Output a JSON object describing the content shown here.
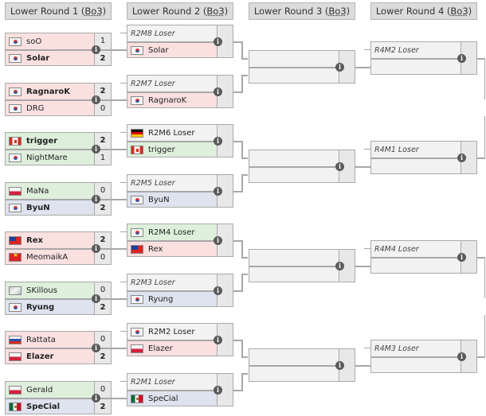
{
  "headers": [
    {
      "prefix": "Lower Round 1 (",
      "abbr": "Bo3",
      "suffix": ")"
    },
    {
      "prefix": "Lower Round 2 (",
      "abbr": "Bo3",
      "suffix": ")"
    },
    {
      "prefix": "Lower Round 3 (",
      "abbr": "Bo3",
      "suffix": ")"
    },
    {
      "prefix": "Lower Round 4 (",
      "abbr": "Bo3",
      "suffix": ")"
    }
  ],
  "round1": [
    {
      "p1": {
        "name": "soO",
        "flag": "kr",
        "score": "1",
        "win": false
      },
      "p2": {
        "name": "Solar",
        "flag": "kr",
        "score": "2",
        "win": true
      },
      "bg": [
        "red",
        "red"
      ]
    },
    {
      "p1": {
        "name": "RagnaroK",
        "flag": "kr",
        "score": "2",
        "win": true
      },
      "p2": {
        "name": "DRG",
        "flag": "kr",
        "score": "0",
        "win": false
      },
      "bg": [
        "red",
        "red"
      ]
    },
    {
      "p1": {
        "name": "trigger",
        "flag": "ca",
        "score": "2",
        "win": true
      },
      "p2": {
        "name": "NightMare",
        "flag": "kr",
        "score": "1",
        "win": false
      },
      "bg": [
        "green",
        "green"
      ]
    },
    {
      "p1": {
        "name": "MaNa",
        "flag": "pl",
        "score": "0",
        "win": false
      },
      "p2": {
        "name": "ByuN",
        "flag": "kr",
        "score": "2",
        "win": true
      },
      "bg": [
        "green",
        "blue"
      ]
    },
    {
      "p1": {
        "name": "Rex",
        "flag": "tw",
        "score": "2",
        "win": true
      },
      "p2": {
        "name": "MeomaikA",
        "flag": "vn",
        "score": "0",
        "win": false
      },
      "bg": [
        "red",
        "red"
      ]
    },
    {
      "p1": {
        "name": "SKillous",
        "flag": "unk",
        "score": "0",
        "win": false
      },
      "p2": {
        "name": "Ryung",
        "flag": "kr",
        "score": "2",
        "win": true
      },
      "bg": [
        "green",
        "blue"
      ]
    },
    {
      "p1": {
        "name": "Rattata",
        "flag": "ru",
        "score": "0",
        "win": false
      },
      "p2": {
        "name": "Elazer",
        "flag": "pl",
        "score": "2",
        "win": true
      },
      "bg": [
        "red",
        "red"
      ]
    },
    {
      "p1": {
        "name": "Gerald",
        "flag": "pl",
        "score": "0",
        "win": false
      },
      "p2": {
        "name": "SpeCial",
        "flag": "mx",
        "score": "2",
        "win": true
      },
      "bg": [
        "green",
        "blue"
      ]
    }
  ],
  "round2": [
    {
      "top": {
        "label": "R2M8 Loser",
        "flag": "",
        "italic": true,
        "bg": "grey"
      },
      "bottom": {
        "label": "Solar",
        "flag": "kr",
        "bg": "red"
      }
    },
    {
      "top": {
        "label": "R2M7 Loser",
        "flag": "",
        "italic": true,
        "bg": "grey"
      },
      "bottom": {
        "label": "RagnaroK",
        "flag": "kr",
        "bg": "red"
      }
    },
    {
      "top": {
        "label": "R2M6 Loser",
        "flag": "de",
        "italic": false,
        "bg": "grey"
      },
      "bottom": {
        "label": "trigger",
        "flag": "ca",
        "bg": "green"
      }
    },
    {
      "top": {
        "label": "R2M5 Loser",
        "flag": "",
        "italic": true,
        "bg": "grey"
      },
      "bottom": {
        "label": "ByuN",
        "flag": "kr",
        "bg": "blue"
      }
    },
    {
      "top": {
        "label": "R2M4 Loser",
        "flag": "kr",
        "italic": false,
        "bg": "green"
      },
      "bottom": {
        "label": "Rex",
        "flag": "tw",
        "bg": "red"
      }
    },
    {
      "top": {
        "label": "R2M3 Loser",
        "flag": "",
        "italic": true,
        "bg": "grey"
      },
      "bottom": {
        "label": "Ryung",
        "flag": "kr",
        "bg": "blue"
      }
    },
    {
      "top": {
        "label": "R2M2 Loser",
        "flag": "kr",
        "italic": false,
        "bg": "grey"
      },
      "bottom": {
        "label": "Elazer",
        "flag": "pl",
        "bg": "red"
      }
    },
    {
      "top": {
        "label": "R2M1 Loser",
        "flag": "",
        "italic": true,
        "bg": "grey"
      },
      "bottom": {
        "label": "SpeCial",
        "flag": "mx",
        "bg": "blue"
      }
    }
  ],
  "round3": [
    {},
    {},
    {},
    {}
  ],
  "round4": [
    {
      "top": {
        "label": "R4M2 Loser"
      }
    },
    {
      "top": {
        "label": "R4M1 Loser"
      }
    },
    {
      "top": {
        "label": "R4M4 Loser"
      }
    },
    {
      "top": {
        "label": "R4M3 Loser"
      }
    }
  ],
  "icons": {
    "info": "i"
  }
}
